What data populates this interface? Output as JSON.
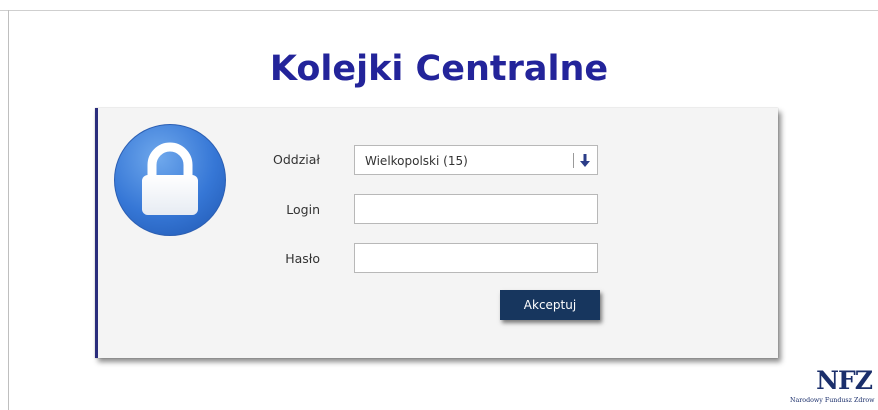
{
  "header": {
    "title": "Kolejki Centralne"
  },
  "form": {
    "branch_label": "Oddział",
    "branch_value": "Wielkopolski (15)",
    "login_label": "Login",
    "login_value": "",
    "password_label": "Hasło",
    "password_value": "",
    "submit_label": "Akceptuj"
  },
  "logo": {
    "mark": "NFZ",
    "caption": "Narodowy Fundusz Zdrow"
  },
  "icons": {
    "lock": "padlock-icon",
    "dropdown": "arrow-down-icon"
  },
  "colors": {
    "title": "#23249a",
    "accent_border": "#2b2d7c",
    "button": "#17365e",
    "lock_blue": "#3677d6",
    "logo": "#1b2f6b"
  }
}
